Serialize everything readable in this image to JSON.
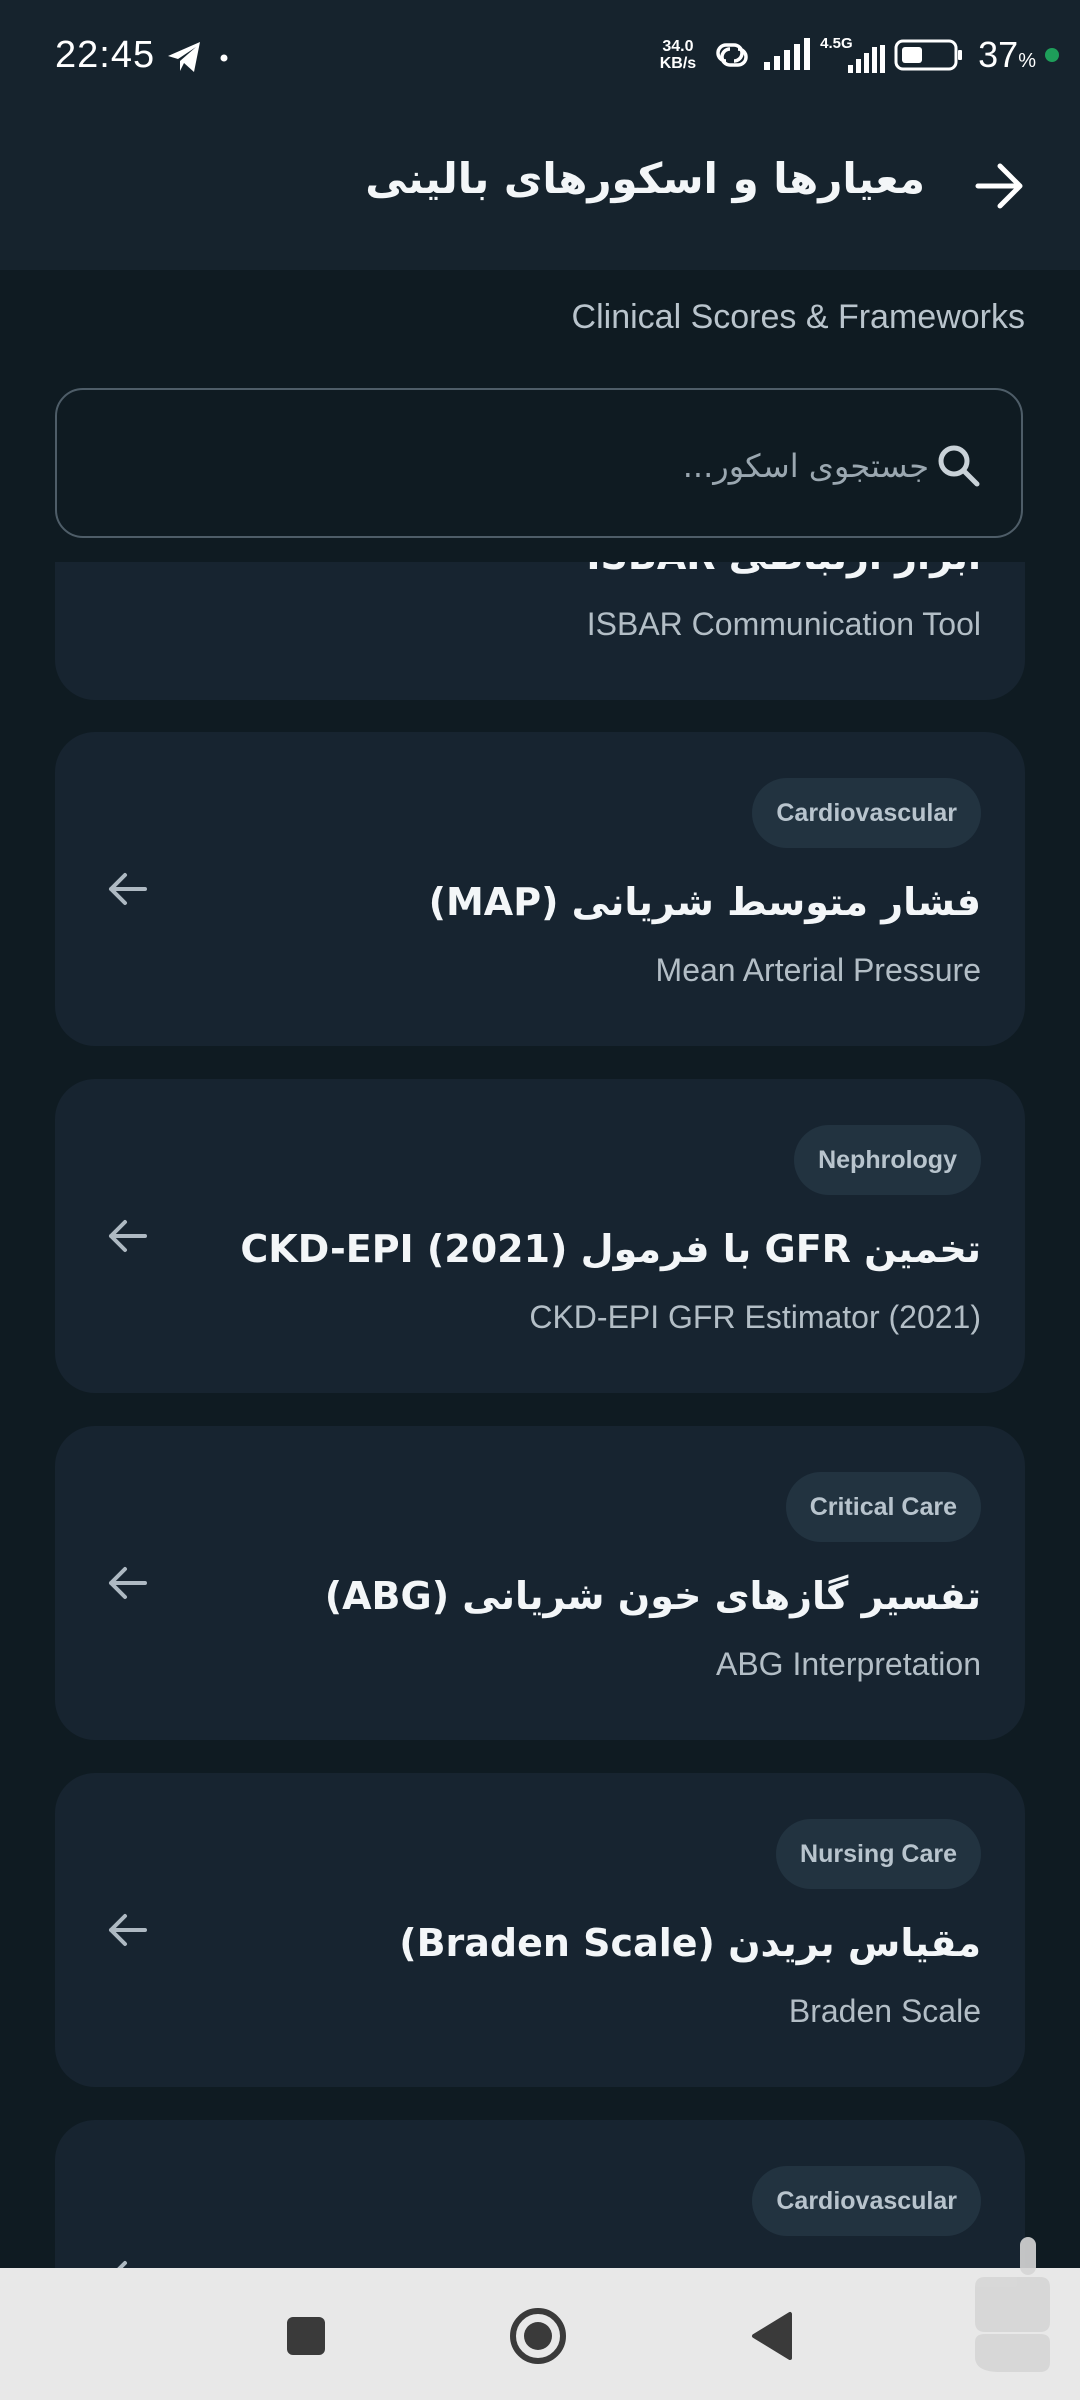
{
  "status_bar": {
    "time": "22:45",
    "net_speed_value": "34.0",
    "net_speed_unit": "KB/s",
    "network_type": "4.5G",
    "battery_percent": "37",
    "battery_symbol": "%",
    "icons": [
      "telegram-icon",
      "dot-icon",
      "link-icon",
      "signal-icon",
      "signal-4g-icon",
      "battery-icon",
      "privacy-dot-icon"
    ]
  },
  "app_bar": {
    "title": "معیارها و اسکورهای بالینی",
    "back_icon": "arrow-right-icon"
  },
  "subtitle": "Clinical Scores & Frameworks",
  "search": {
    "placeholder": "جستجوی اسکور..."
  },
  "cards": [
    {
      "badge": "",
      "title": "ابزار ارتباطی ISBAR",
      "subtitle": "ISBAR Communication Tool"
    },
    {
      "badge": "Cardiovascular",
      "title": "فشار متوسط شریانی (MAP)",
      "subtitle": "Mean Arterial Pressure"
    },
    {
      "badge": "Nephrology",
      "title": "تخمین GFR با فرمول CKD-EPI (2021)",
      "subtitle": "CKD-EPI GFR Estimator (2021)"
    },
    {
      "badge": "Critical Care",
      "title": "تفسیر گازهای خون شریانی (ABG)",
      "subtitle": "ABG Interpretation"
    },
    {
      "badge": "Nursing Care",
      "title": "مقیاس بریدن (Braden Scale)",
      "subtitle": "Braden Scale"
    },
    {
      "badge": "Cardiovascular",
      "title": "",
      "subtitle": ""
    }
  ],
  "nav_bar": {
    "icons": [
      "recents-square-icon",
      "home-circle-icon",
      "back-triangle-icon"
    ]
  },
  "colors": {
    "background": "#0f1b22",
    "app_bar": "#16232d",
    "card": "#172430",
    "badge": "#223340",
    "text_primary": "#f3f6f8",
    "text_secondary": "#b3bec6"
  }
}
